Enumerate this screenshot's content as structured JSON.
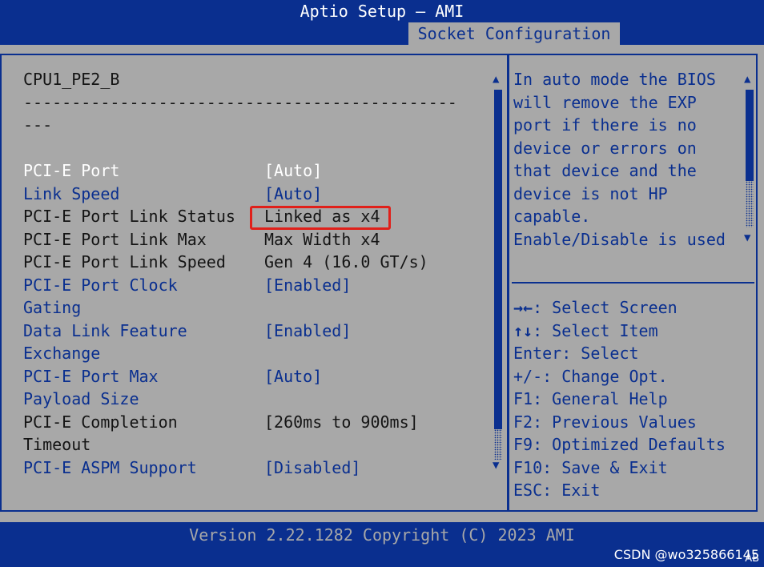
{
  "header": {
    "title": "Aptio Setup – AMI",
    "active_tab": "Socket Configuration"
  },
  "main": {
    "heading": "CPU1_PE2_B",
    "separator_line1": "---------------------------------------------",
    "separator_line2": "---",
    "rows": [
      {
        "label": "PCI-E Port",
        "value": "[Auto]"
      },
      {
        "label": "Link Speed",
        "value": "[Auto]"
      },
      {
        "label": "PCI-E Port Link Status",
        "value": "Linked as x4"
      },
      {
        "label": "PCI-E Port Link Max",
        "value": "Max Width x4"
      },
      {
        "label": "PCI-E Port Link Speed",
        "value": "Gen 4 (16.0 GT/s)"
      },
      {
        "label": "PCI-E Port Clock",
        "label2": "Gating",
        "value": "[Enabled]"
      },
      {
        "label": "Data Link Feature",
        "label2": "Exchange",
        "value": "[Enabled]"
      },
      {
        "label": "PCI-E Port Max",
        "label2": "Payload Size",
        "value": "[Auto]"
      },
      {
        "label": "PCI-E Completion",
        "label2": "Timeout",
        "value": "[260ms to 900ms]"
      },
      {
        "label": "PCI-E ASPM Support",
        "value": "[Disabled]"
      }
    ]
  },
  "help": {
    "text": [
      "In auto mode the BIOS",
      "will remove the EXP",
      "port if there is no",
      "device or errors on",
      "that device and the",
      "device is not HP",
      "capable.",
      "Enable/Disable is used"
    ]
  },
  "keys": [
    {
      "key": "→←",
      "desc": ": Select Screen"
    },
    {
      "key": "↑↓",
      "desc": ": Select Item"
    },
    {
      "key": "",
      "desc": "Enter: Select"
    },
    {
      "key": "",
      "desc": "+/-: Change Opt."
    },
    {
      "key": "",
      "desc": "F1: General Help"
    },
    {
      "key": "",
      "desc": "F2: Previous Values"
    },
    {
      "key": "",
      "desc": "F9: Optimized Defaults"
    },
    {
      "key": "",
      "desc": "F10: Save & Exit"
    },
    {
      "key": "",
      "desc": "ESC: Exit"
    }
  ],
  "footer": {
    "version": "Version 2.22.1282 Copyright (C) 2023 AMI"
  },
  "watermark": "CSDN @wo325866145",
  "overlay_text": "AB",
  "colors": {
    "bios_blue": "#0a2f8f",
    "panel_gray": "#a8a8a8",
    "highlight_red": "#e0201a"
  }
}
